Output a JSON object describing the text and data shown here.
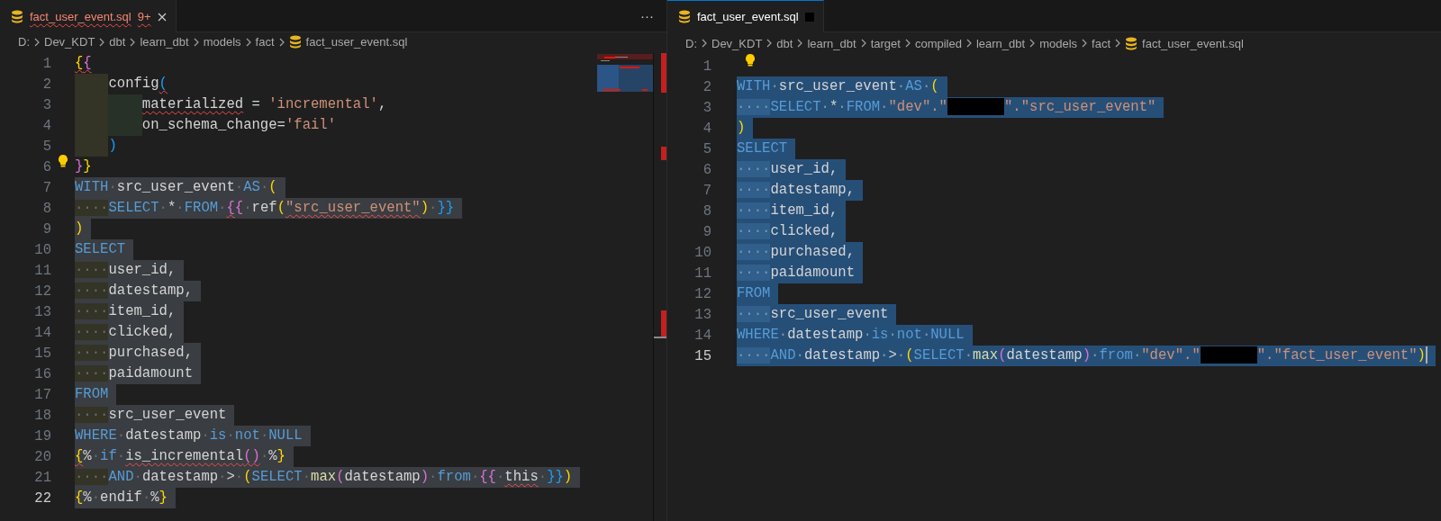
{
  "panes": [
    {
      "focused": false,
      "minimap": true,
      "overview_ruler": true,
      "tab": {
        "label": "fact_user_event.sql",
        "kind": "errors",
        "badge": "9+",
        "selected": true
      },
      "actions": "···",
      "breadcrumbs": [
        "D:",
        "Dev_KDT",
        "dbt",
        "learn_dbt",
        "models",
        "fact",
        "fact_user_event.sql"
      ],
      "lines": [
        {
          "number": "1",
          "selected": false,
          "current": false,
          "lightbulb": false,
          "tokens": [
            {
              "kind": "b1",
              "text": "{",
              "squiggle": true
            },
            {
              "kind": "b2",
              "text": "{",
              "squiggle": true
            }
          ]
        },
        {
          "number": "2",
          "selected": false,
          "current": false,
          "lightbulb": false,
          "tokens": [
            {
              "kind": "guide1"
            },
            {
              "kind": "id",
              "text": "config"
            },
            {
              "kind": "b3",
              "text": "(",
              "squiggle": true
            }
          ]
        },
        {
          "number": "3",
          "selected": false,
          "current": false,
          "lightbulb": false,
          "tokens": [
            {
              "kind": "guide1"
            },
            {
              "kind": "guide2"
            },
            {
              "kind": "id",
              "text": "materialized",
              "squiggle": true
            },
            {
              "kind": "id",
              "text": " = "
            },
            {
              "kind": "str",
              "text": "'incremental'"
            },
            {
              "kind": "id",
              "text": ","
            }
          ]
        },
        {
          "number": "4",
          "selected": false,
          "current": false,
          "lightbulb": false,
          "tokens": [
            {
              "kind": "guide1"
            },
            {
              "kind": "guide2"
            },
            {
              "kind": "id",
              "text": "on_schema_change="
            },
            {
              "kind": "str",
              "text": "'fail'"
            }
          ]
        },
        {
          "number": "5",
          "selected": false,
          "current": false,
          "lightbulb": false,
          "tokens": [
            {
              "kind": "guide1"
            },
            {
              "kind": "b3",
              "text": ")"
            }
          ]
        },
        {
          "number": "6",
          "selected": false,
          "current": false,
          "lightbulb": true,
          "tokens": [
            {
              "kind": "b2",
              "text": "}"
            },
            {
              "kind": "b1",
              "text": "}"
            }
          ]
        },
        {
          "number": "7",
          "selected": true,
          "current": false,
          "lightbulb": false,
          "tokens": [
            {
              "kind": "kw",
              "text": "WITH"
            },
            {
              "kind": "ws",
              "text": "·"
            },
            {
              "kind": "id",
              "text": "src_user_event"
            },
            {
              "kind": "ws",
              "text": "·"
            },
            {
              "kind": "kw",
              "text": "AS"
            },
            {
              "kind": "ws",
              "text": "·"
            },
            {
              "kind": "b1",
              "text": "("
            }
          ]
        },
        {
          "number": "8",
          "selected": true,
          "current": false,
          "lightbulb": false,
          "tokens": [
            {
              "kind": "indent",
              "text": "····"
            },
            {
              "kind": "kw",
              "text": "SELECT"
            },
            {
              "kind": "ws",
              "text": "·"
            },
            {
              "kind": "id",
              "text": "*"
            },
            {
              "kind": "ws",
              "text": "·"
            },
            {
              "kind": "kw",
              "text": "FROM"
            },
            {
              "kind": "ws",
              "text": "·"
            },
            {
              "kind": "b2",
              "text": "{",
              "squiggle": true
            },
            {
              "kind": "b2",
              "text": "{"
            },
            {
              "kind": "ws",
              "text": "·"
            },
            {
              "kind": "id",
              "text": "ref"
            },
            {
              "kind": "b1",
              "text": "("
            },
            {
              "kind": "str",
              "text": "\"src_user_event\"",
              "squiggle": true
            },
            {
              "kind": "b1",
              "text": ")"
            },
            {
              "kind": "ws",
              "text": "·"
            },
            {
              "kind": "b3",
              "text": "}}"
            }
          ]
        },
        {
          "number": "9",
          "selected": true,
          "current": false,
          "lightbulb": false,
          "tokens": [
            {
              "kind": "b1",
              "text": ")"
            }
          ]
        },
        {
          "number": "10",
          "selected": true,
          "current": false,
          "lightbulb": false,
          "tokens": [
            {
              "kind": "kw",
              "text": "SELECT"
            }
          ]
        },
        {
          "number": "11",
          "selected": true,
          "current": false,
          "lightbulb": false,
          "tokens": [
            {
              "kind": "indent",
              "text": "····"
            },
            {
              "kind": "id",
              "text": "user_id,"
            }
          ]
        },
        {
          "number": "12",
          "selected": true,
          "current": false,
          "lightbulb": false,
          "tokens": [
            {
              "kind": "indent",
              "text": "····"
            },
            {
              "kind": "id",
              "text": "datestamp,"
            }
          ]
        },
        {
          "number": "13",
          "selected": true,
          "current": false,
          "lightbulb": false,
          "tokens": [
            {
              "kind": "indent",
              "text": "····"
            },
            {
              "kind": "id",
              "text": "item_id,"
            }
          ]
        },
        {
          "number": "14",
          "selected": true,
          "current": false,
          "lightbulb": false,
          "tokens": [
            {
              "kind": "indent",
              "text": "····"
            },
            {
              "kind": "id",
              "text": "clicked,"
            }
          ]
        },
        {
          "number": "15",
          "selected": true,
          "current": false,
          "lightbulb": false,
          "tokens": [
            {
              "kind": "indent",
              "text": "····"
            },
            {
              "kind": "id",
              "text": "purchased,"
            }
          ]
        },
        {
          "number": "16",
          "selected": true,
          "current": false,
          "lightbulb": false,
          "tokens": [
            {
              "kind": "indent",
              "text": "····"
            },
            {
              "kind": "id",
              "text": "paidamount"
            }
          ]
        },
        {
          "number": "17",
          "selected": true,
          "current": false,
          "lightbulb": false,
          "tokens": [
            {
              "kind": "kw",
              "text": "FROM"
            }
          ]
        },
        {
          "number": "18",
          "selected": true,
          "current": false,
          "lightbulb": false,
          "tokens": [
            {
              "kind": "indent",
              "text": "····"
            },
            {
              "kind": "id",
              "text": "src_user_event"
            }
          ]
        },
        {
          "number": "19",
          "selected": true,
          "current": false,
          "lightbulb": false,
          "tokens": [
            {
              "kind": "kw",
              "text": "WHERE"
            },
            {
              "kind": "ws",
              "text": "·"
            },
            {
              "kind": "id",
              "text": "datestamp"
            },
            {
              "kind": "ws",
              "text": "·"
            },
            {
              "kind": "kw",
              "text": "is"
            },
            {
              "kind": "ws",
              "text": "·"
            },
            {
              "kind": "kw",
              "text": "not"
            },
            {
              "kind": "ws",
              "text": "·"
            },
            {
              "kind": "kw",
              "text": "NULL"
            }
          ]
        },
        {
          "number": "20",
          "selected": true,
          "current": false,
          "lightbulb": false,
          "tokens": [
            {
              "kind": "b1",
              "text": "{",
              "squiggle": true
            },
            {
              "kind": "id",
              "text": "%"
            },
            {
              "kind": "ws",
              "text": "·"
            },
            {
              "kind": "kw",
              "text": "if"
            },
            {
              "kind": "ws",
              "text": "·"
            },
            {
              "kind": "id",
              "text": "is_incremental",
              "squiggle": true
            },
            {
              "kind": "b2",
              "text": "()",
              "squiggle": true
            },
            {
              "kind": "ws",
              "text": "·"
            },
            {
              "kind": "id",
              "text": "%"
            },
            {
              "kind": "b1",
              "text": "}"
            }
          ]
        },
        {
          "number": "21",
          "selected": true,
          "current": false,
          "lightbulb": false,
          "tokens": [
            {
              "kind": "indent",
              "text": "····"
            },
            {
              "kind": "kw",
              "text": "AND"
            },
            {
              "kind": "ws",
              "text": "·"
            },
            {
              "kind": "id",
              "text": "datestamp"
            },
            {
              "kind": "ws",
              "text": "·"
            },
            {
              "kind": "id",
              "text": ">"
            },
            {
              "kind": "ws",
              "text": "·"
            },
            {
              "kind": "b1",
              "text": "("
            },
            {
              "kind": "kw",
              "text": "SELECT"
            },
            {
              "kind": "ws",
              "text": "·"
            },
            {
              "kind": "fn",
              "text": "max"
            },
            {
              "kind": "b2",
              "text": "("
            },
            {
              "kind": "id",
              "text": "datestamp"
            },
            {
              "kind": "b2",
              "text": ")"
            },
            {
              "kind": "ws",
              "text": "·"
            },
            {
              "kind": "kw",
              "text": "from"
            },
            {
              "kind": "ws",
              "text": "·"
            },
            {
              "kind": "b2",
              "text": "{{"
            },
            {
              "kind": "ws",
              "text": "·"
            },
            {
              "kind": "id",
              "text": "this",
              "squiggle": true
            },
            {
              "kind": "ws",
              "text": "·"
            },
            {
              "kind": "b3",
              "text": "}}"
            },
            {
              "kind": "b1",
              "text": ")"
            }
          ]
        },
        {
          "number": "22",
          "selected": true,
          "current": true,
          "lightbulb": false,
          "tokens": [
            {
              "kind": "b1",
              "text": "{"
            },
            {
              "kind": "id",
              "text": "%"
            },
            {
              "kind": "ws",
              "text": "·"
            },
            {
              "kind": "id",
              "text": "endif"
            },
            {
              "kind": "ws",
              "text": "·"
            },
            {
              "kind": "id",
              "text": "%"
            },
            {
              "kind": "b1",
              "text": "}"
            }
          ]
        }
      ]
    },
    {
      "focused": true,
      "minimap": false,
      "overview_ruler": false,
      "tab": {
        "label": "fact_user_event.sql",
        "kind": "marked",
        "selected": true
      },
      "breadcrumbs": [
        "D:",
        "Dev_KDT",
        "dbt",
        "learn_dbt",
        "target",
        "compiled",
        "learn_dbt",
        "models",
        "fact",
        "fact_user_event.sql"
      ],
      "lines": [
        {
          "number": "1",
          "selected": false,
          "current": false,
          "lightbulb": true
        },
        {
          "number": "2",
          "selected": true,
          "current": false,
          "lightbulb": false,
          "tokens": [
            {
              "kind": "kw",
              "text": "WITH"
            },
            {
              "kind": "ws",
              "text": "·"
            },
            {
              "kind": "id",
              "text": "src_user_event"
            },
            {
              "kind": "ws",
              "text": "·"
            },
            {
              "kind": "kw",
              "text": "AS"
            },
            {
              "kind": "ws",
              "text": "·"
            },
            {
              "kind": "b1",
              "text": "("
            }
          ]
        },
        {
          "number": "3",
          "selected": true,
          "current": false,
          "lightbulb": false,
          "tokens": [
            {
              "kind": "indent",
              "text": "····"
            },
            {
              "kind": "kw",
              "text": "SELECT"
            },
            {
              "kind": "ws",
              "text": "·"
            },
            {
              "kind": "id",
              "text": "*"
            },
            {
              "kind": "ws",
              "text": "·"
            },
            {
              "kind": "kw",
              "text": "FROM"
            },
            {
              "kind": "ws",
              "text": "·"
            },
            {
              "kind": "str",
              "text": "\"dev\".\""
            },
            {
              "kind": "redacted"
            },
            {
              "kind": "str",
              "text": "\".\"src_user_event\""
            }
          ]
        },
        {
          "number": "4",
          "selected": true,
          "current": false,
          "lightbulb": false,
          "tokens": [
            {
              "kind": "b1",
              "text": ")"
            }
          ]
        },
        {
          "number": "5",
          "selected": true,
          "current": false,
          "lightbulb": false,
          "tokens": [
            {
              "kind": "kw",
              "text": "SELECT"
            }
          ]
        },
        {
          "number": "6",
          "selected": true,
          "current": false,
          "lightbulb": false,
          "tokens": [
            {
              "kind": "indent",
              "text": "····"
            },
            {
              "kind": "id",
              "text": "user_id,"
            }
          ]
        },
        {
          "number": "7",
          "selected": true,
          "current": false,
          "lightbulb": false,
          "tokens": [
            {
              "kind": "indent",
              "text": "····"
            },
            {
              "kind": "id",
              "text": "datestamp,"
            }
          ]
        },
        {
          "number": "8",
          "selected": true,
          "current": false,
          "lightbulb": false,
          "tokens": [
            {
              "kind": "indent",
              "text": "····"
            },
            {
              "kind": "id",
              "text": "item_id,"
            }
          ]
        },
        {
          "number": "9",
          "selected": true,
          "current": false,
          "lightbulb": false,
          "tokens": [
            {
              "kind": "indent",
              "text": "····"
            },
            {
              "kind": "id",
              "text": "clicked,"
            }
          ]
        },
        {
          "number": "10",
          "selected": true,
          "current": false,
          "lightbulb": false,
          "tokens": [
            {
              "kind": "indent",
              "text": "····"
            },
            {
              "kind": "id",
              "text": "purchased,"
            }
          ]
        },
        {
          "number": "11",
          "selected": true,
          "current": false,
          "lightbulb": false,
          "tokens": [
            {
              "kind": "indent",
              "text": "····"
            },
            {
              "kind": "id",
              "text": "paidamount"
            }
          ]
        },
        {
          "number": "12",
          "selected": true,
          "current": false,
          "lightbulb": false,
          "tokens": [
            {
              "kind": "kw",
              "text": "FROM"
            }
          ]
        },
        {
          "number": "13",
          "selected": true,
          "current": false,
          "lightbulb": false,
          "tokens": [
            {
              "kind": "indent",
              "text": "····"
            },
            {
              "kind": "id",
              "text": "src_user_event"
            }
          ]
        },
        {
          "number": "14",
          "selected": true,
          "current": false,
          "lightbulb": false,
          "tokens": [
            {
              "kind": "kw",
              "text": "WHERE"
            },
            {
              "kind": "ws",
              "text": "·"
            },
            {
              "kind": "id",
              "text": "datestamp"
            },
            {
              "kind": "ws",
              "text": "·"
            },
            {
              "kind": "kw",
              "text": "is"
            },
            {
              "kind": "ws",
              "text": "·"
            },
            {
              "kind": "kw",
              "text": "not"
            },
            {
              "kind": "ws",
              "text": "·"
            },
            {
              "kind": "kw",
              "text": "NULL"
            }
          ]
        },
        {
          "number": "15",
          "selected": true,
          "current": true,
          "lightbulb": false,
          "tokens": [
            {
              "kind": "indent",
              "text": "····"
            },
            {
              "kind": "kw",
              "text": "AND"
            },
            {
              "kind": "ws",
              "text": "·"
            },
            {
              "kind": "id",
              "text": "datestamp"
            },
            {
              "kind": "ws",
              "text": "·"
            },
            {
              "kind": "id",
              "text": ">"
            },
            {
              "kind": "ws",
              "text": "·"
            },
            {
              "kind": "b1",
              "text": "("
            },
            {
              "kind": "kw",
              "text": "SELECT"
            },
            {
              "kind": "ws",
              "text": "·"
            },
            {
              "kind": "fn",
              "text": "max"
            },
            {
              "kind": "b2",
              "text": "("
            },
            {
              "kind": "id",
              "text": "datestamp"
            },
            {
              "kind": "b2",
              "text": ")"
            },
            {
              "kind": "ws",
              "text": "·"
            },
            {
              "kind": "kw",
              "text": "from"
            },
            {
              "kind": "ws",
              "text": "·"
            },
            {
              "kind": "str",
              "text": "\"dev\".\""
            },
            {
              "kind": "redacted"
            },
            {
              "kind": "str",
              "text": "\".\"fact_user_event\""
            },
            {
              "kind": "b1",
              "text": ")"
            }
          ]
        }
      ]
    }
  ]
}
